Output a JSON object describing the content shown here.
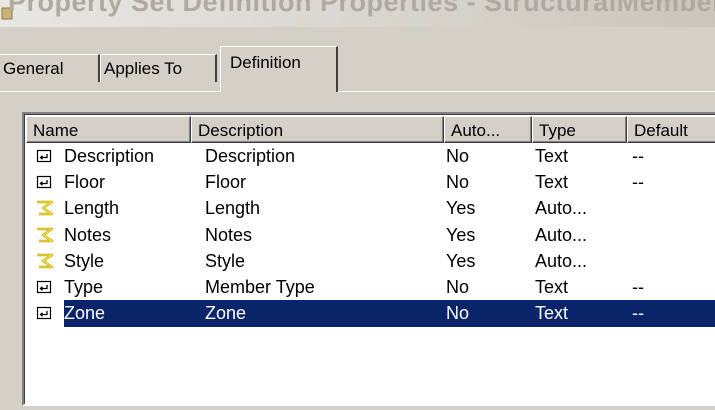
{
  "window": {
    "title": "Property Set Definition Properties - StructuralMember"
  },
  "tabs": [
    {
      "label": "General"
    },
    {
      "label": "Applies To"
    },
    {
      "label": "Definition"
    }
  ],
  "table": {
    "columns": [
      "Name",
      "Description",
      "Auto...",
      "Type",
      "Default"
    ],
    "rows": [
      {
        "icon": "manual-property-icon",
        "name": "Description",
        "description": "Description",
        "auto": "No",
        "type": "Text",
        "default": "--"
      },
      {
        "icon": "manual-property-icon",
        "name": "Floor",
        "description": "Floor",
        "auto": "No",
        "type": "Text",
        "default": "--"
      },
      {
        "icon": "automatic-property-icon",
        "name": "Length",
        "description": "Length",
        "auto": "Yes",
        "type": "Auto...",
        "default": ""
      },
      {
        "icon": "automatic-property-icon",
        "name": "Notes",
        "description": "Notes",
        "auto": "Yes",
        "type": "Auto...",
        "default": ""
      },
      {
        "icon": "automatic-property-icon",
        "name": "Style",
        "description": "Style",
        "auto": "Yes",
        "type": "Auto...",
        "default": ""
      },
      {
        "icon": "manual-property-icon",
        "name": "Type",
        "description": "Member Type",
        "auto": "No",
        "type": "Text",
        "default": "--"
      },
      {
        "icon": "manual-property-icon",
        "name": "Zone",
        "description": "Zone",
        "auto": "No",
        "type": "Text",
        "default": "--",
        "selected": true
      }
    ]
  },
  "colors": {
    "selection": "#0a246a",
    "face": "#d4d0c8"
  }
}
